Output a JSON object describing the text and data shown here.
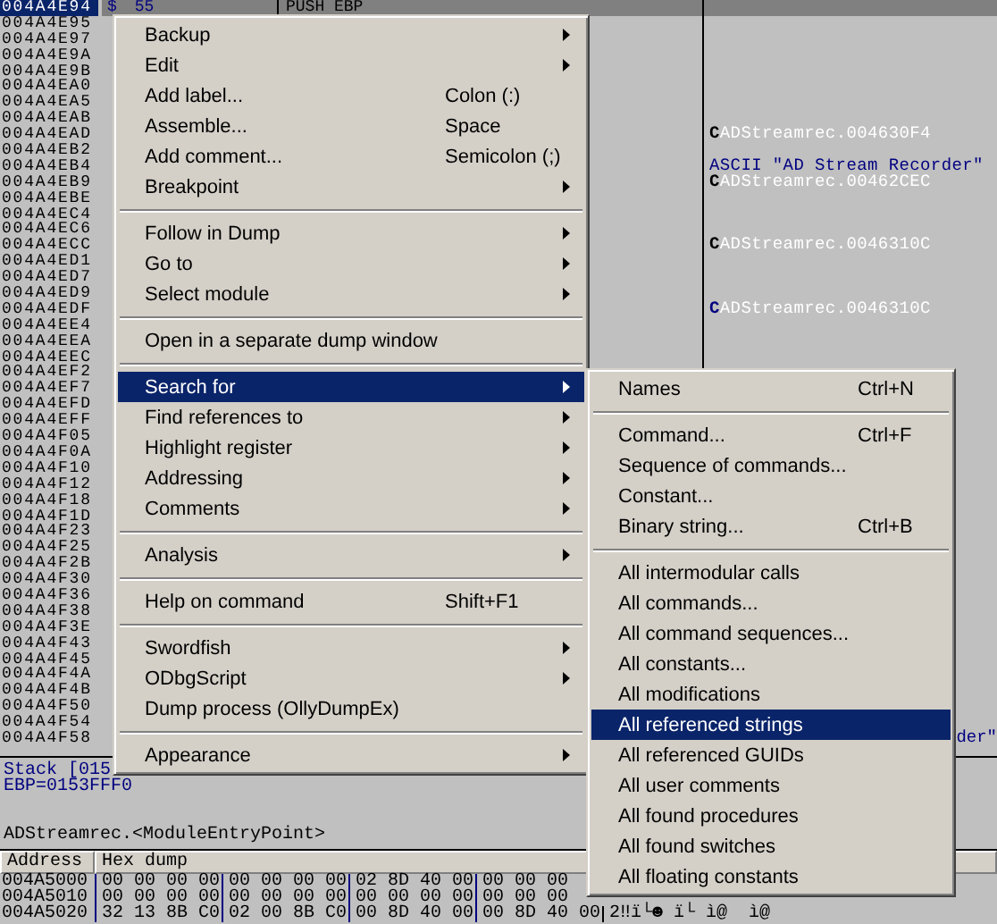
{
  "disassembly": {
    "rows": [
      {
        "address": "004A4E94",
        "selected": true,
        "hex": "55",
        "flag": "$",
        "command": "PUSH EBP"
      },
      {
        "address": "004A4E95",
        "selected": false
      },
      {
        "address": "004A4E97",
        "selected": false
      },
      {
        "address": "004A4E9A",
        "selected": false
      },
      {
        "address": "004A4E9B",
        "selected": false
      },
      {
        "address": "004A4EA0",
        "selected": false
      },
      {
        "address": "004A4EA5",
        "selected": false
      },
      {
        "address": "004A4EAB",
        "selected": false
      },
      {
        "address": "004A4EAD",
        "selected": false,
        "comment": {
          "kind": "call",
          "marker": "C",
          "color": "#000000",
          "text": "ADStreamrec.004630F4"
        }
      },
      {
        "address": "004A4EB2",
        "selected": false
      },
      {
        "address": "004A4EB4",
        "selected": false,
        "comment": {
          "kind": "ascii",
          "text": "ASCII \"AD Stream Recorder\""
        }
      },
      {
        "address": "004A4EB9",
        "selected": false,
        "comment": {
          "kind": "call",
          "marker": "C",
          "color": "#000000",
          "text": "ADStreamrec.00462CEC"
        }
      },
      {
        "address": "004A4EBE",
        "selected": false
      },
      {
        "address": "004A4EC4",
        "selected": false
      },
      {
        "address": "004A4EC6",
        "selected": false
      },
      {
        "address": "004A4ECC",
        "selected": false,
        "comment": {
          "kind": "call",
          "marker": "C",
          "color": "#000000",
          "text": "ADStreamrec.0046310C"
        }
      },
      {
        "address": "004A4ED1",
        "selected": false
      },
      {
        "address": "004A4ED7",
        "selected": false
      },
      {
        "address": "004A4ED9",
        "selected": false
      },
      {
        "address": "004A4EDF",
        "selected": false,
        "comment": {
          "kind": "call",
          "marker": "C",
          "color": "#000080",
          "text": "ADStreamrec.0046310C"
        }
      },
      {
        "address": "004A4EE4",
        "selected": false
      },
      {
        "address": "004A4EEA",
        "selected": false
      },
      {
        "address": "004A4EEC",
        "selected": false
      },
      {
        "address": "004A4EF2",
        "selected": false
      },
      {
        "address": "004A4EF7",
        "selected": false
      },
      {
        "address": "004A4EFD",
        "selected": false
      },
      {
        "address": "004A4EFF",
        "selected": false
      },
      {
        "address": "004A4F05",
        "selected": false
      },
      {
        "address": "004A4F0A",
        "selected": false
      },
      {
        "address": "004A4F10",
        "selected": false
      },
      {
        "address": "004A4F12",
        "selected": false
      },
      {
        "address": "004A4F18",
        "selected": false
      },
      {
        "address": "004A4F1D",
        "selected": false
      },
      {
        "address": "004A4F23",
        "selected": false
      },
      {
        "address": "004A4F25",
        "selected": false
      },
      {
        "address": "004A4F2B",
        "selected": false
      },
      {
        "address": "004A4F30",
        "selected": false
      },
      {
        "address": "004A4F36",
        "selected": false
      },
      {
        "address": "004A4F38",
        "selected": false
      },
      {
        "address": "004A4F3E",
        "selected": false
      },
      {
        "address": "004A4F43",
        "selected": false
      },
      {
        "address": "004A4F45",
        "selected": false
      },
      {
        "address": "004A4F4A",
        "selected": false
      },
      {
        "address": "004A4F4B",
        "selected": false
      },
      {
        "address": "004A4F50",
        "selected": false
      },
      {
        "address": "004A4F54",
        "selected": false
      },
      {
        "address": "004A4F58",
        "selected": false,
        "comment": {
          "kind": "ascii_tail",
          "text": "der\""
        }
      }
    ]
  },
  "info_pane": {
    "lines": [
      "Stack [015",
      "EBP=0153FFF0"
    ],
    "symbol": "ADStreamrec.<ModuleEntryPoint>"
  },
  "dump": {
    "columns": [
      "Address",
      "Hex dump"
    ],
    "rows": [
      {
        "address": "004A5000",
        "groups": [
          "00 00 00 00",
          "00 00 00 00",
          "02 8D 40 00",
          "00 00 00"
        ]
      },
      {
        "address": "004A5010",
        "groups": [
          "00 00 00 00",
          "00 00 00 00",
          "00 00 00 00",
          "00 00 00"
        ]
      },
      {
        "address": "004A5020",
        "groups": [
          "32 13 8B C0",
          "02 00 8B C0",
          "00 8D 40 00",
          "00 8D 40 00"
        ],
        "ascii": "2‼ï└☻ ï└ ì@  ì@"
      }
    ]
  },
  "context_menu": {
    "items": [
      {
        "kind": "submenu",
        "label": "Backup",
        "selected": false
      },
      {
        "kind": "submenu",
        "label": "Edit",
        "selected": false
      },
      {
        "kind": "item",
        "label": "Add label...",
        "shortcut": "Colon (:)",
        "selected": false
      },
      {
        "kind": "item",
        "label": "Assemble...",
        "shortcut": "Space",
        "selected": false
      },
      {
        "kind": "item",
        "label": "Add comment...",
        "shortcut": "Semicolon (;)",
        "selected": false
      },
      {
        "kind": "submenu",
        "label": "Breakpoint",
        "selected": false
      },
      {
        "kind": "separator"
      },
      {
        "kind": "submenu",
        "label": "Follow in Dump",
        "selected": false
      },
      {
        "kind": "submenu",
        "label": "Go to",
        "selected": false
      },
      {
        "kind": "submenu",
        "label": "Select module",
        "selected": false
      },
      {
        "kind": "separator"
      },
      {
        "kind": "item",
        "label": "Open in a separate dump window",
        "selected": false
      },
      {
        "kind": "separator"
      },
      {
        "kind": "submenu",
        "label": "Search for",
        "selected": true
      },
      {
        "kind": "submenu",
        "label": "Find references to",
        "selected": false
      },
      {
        "kind": "submenu",
        "label": "Highlight register",
        "selected": false
      },
      {
        "kind": "submenu",
        "label": "Addressing",
        "selected": false
      },
      {
        "kind": "submenu",
        "label": "Comments",
        "selected": false
      },
      {
        "kind": "separator"
      },
      {
        "kind": "submenu",
        "label": "Analysis",
        "selected": false
      },
      {
        "kind": "separator"
      },
      {
        "kind": "item",
        "label": "Help on command",
        "shortcut": "Shift+F1",
        "selected": false
      },
      {
        "kind": "separator"
      },
      {
        "kind": "submenu",
        "label": "Swordfish",
        "selected": false
      },
      {
        "kind": "submenu",
        "label": "ODbgScript",
        "selected": false
      },
      {
        "kind": "item",
        "label": "Dump process (OllyDumpEx)",
        "selected": false
      },
      {
        "kind": "separator"
      },
      {
        "kind": "submenu",
        "label": "Appearance",
        "selected": false
      }
    ]
  },
  "search_submenu": {
    "items": [
      {
        "kind": "item",
        "label": "Names",
        "shortcut": "Ctrl+N",
        "selected": false
      },
      {
        "kind": "separator"
      },
      {
        "kind": "item",
        "label": "Command...",
        "shortcut": "Ctrl+F",
        "selected": false
      },
      {
        "kind": "item",
        "label": "Sequence of commands...",
        "selected": false
      },
      {
        "kind": "item",
        "label": "Constant...",
        "selected": false
      },
      {
        "kind": "item",
        "label": "Binary string...",
        "shortcut": "Ctrl+B",
        "selected": false
      },
      {
        "kind": "separator"
      },
      {
        "kind": "item",
        "label": "All intermodular calls",
        "selected": false
      },
      {
        "kind": "item",
        "label": "All commands...",
        "selected": false
      },
      {
        "kind": "item",
        "label": "All command sequences...",
        "selected": false
      },
      {
        "kind": "item",
        "label": "All constants...",
        "selected": false
      },
      {
        "kind": "item",
        "label": "All modifications",
        "selected": false
      },
      {
        "kind": "item",
        "label": "All referenced strings",
        "selected": true
      },
      {
        "kind": "item",
        "label": "All referenced GUIDs",
        "selected": false
      },
      {
        "kind": "item",
        "label": "All user comments",
        "selected": false
      },
      {
        "kind": "item",
        "label": "All found procedures",
        "selected": false
      },
      {
        "kind": "item",
        "label": "All found switches",
        "selected": false
      },
      {
        "kind": "item",
        "label": "All floating constants",
        "selected": false
      }
    ]
  }
}
